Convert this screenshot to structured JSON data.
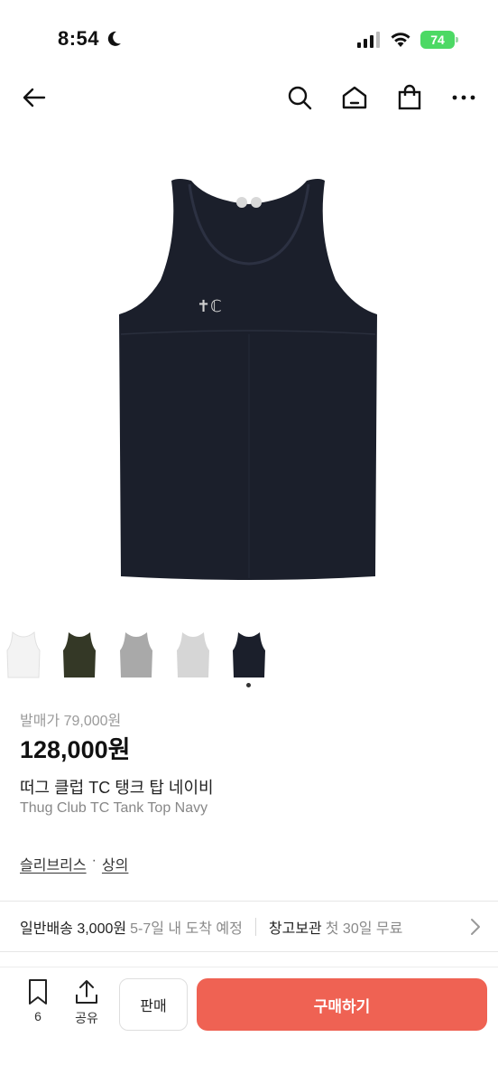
{
  "status_bar": {
    "time": "8:54",
    "battery": "74"
  },
  "nav": {
    "icons": [
      "back-arrow-icon",
      "search-icon",
      "home-icon",
      "shopping-bag-icon",
      "more-icon"
    ]
  },
  "product": {
    "image_color": "#1b1f2b",
    "thumbnails": [
      {
        "color": "white",
        "fill": "#f3f3f3"
      },
      {
        "color": "khaki",
        "fill": "#343826"
      },
      {
        "color": "gray",
        "fill": "#a9a9a9"
      },
      {
        "color": "light-gray",
        "fill": "#d6d6d6"
      },
      {
        "color": "navy",
        "fill": "#1b1f2b",
        "selected": true
      }
    ],
    "original_price": "발매가 79,000원",
    "price": "128,000원",
    "name_kr": "떠그 클럽 TC 탱크 탑 네이비",
    "name_en": "Thug Club TC Tank Top Navy",
    "breadcrumb": {
      "brand": "슬리브리스",
      "separator": "·",
      "category": "상의"
    }
  },
  "shipping": {
    "standard_label": "일반배송 3,000원",
    "standard_eta": "5-7일 내 도착 예정",
    "warehouse_label": "창고보관",
    "warehouse_note": "첫 30일 무료"
  },
  "bottom_bar": {
    "bookmark_count": "6",
    "share_label": "공유",
    "sell_label": "판매",
    "buy_label": "구매하기",
    "accent_color": "#ef6253"
  }
}
